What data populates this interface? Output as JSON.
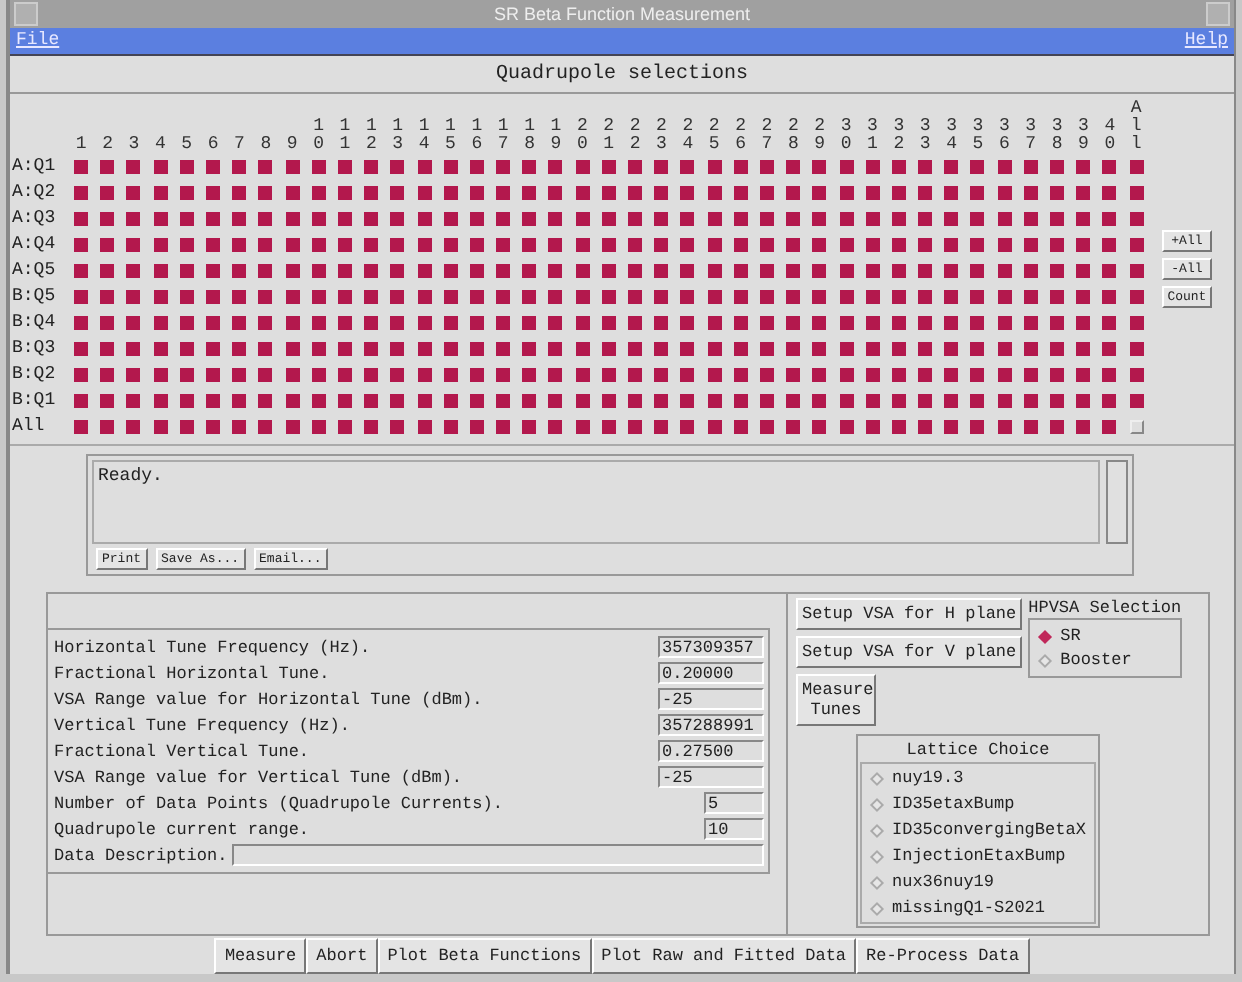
{
  "window": {
    "title": "SR Beta Function Measurement"
  },
  "menu": [
    {
      "label": "File"
    },
    {
      "label": "Help"
    }
  ],
  "grid": {
    "title": "Quadrupole selections",
    "columns": [
      "1",
      "2",
      "3",
      "4",
      "5",
      "6",
      "7",
      "8",
      "9",
      "10",
      "11",
      "12",
      "13",
      "14",
      "15",
      "16",
      "17",
      "18",
      "19",
      "20",
      "21",
      "22",
      "23",
      "24",
      "25",
      "26",
      "27",
      "28",
      "29",
      "30",
      "31",
      "32",
      "33",
      "34",
      "35",
      "36",
      "37",
      "38",
      "39",
      "40",
      "All"
    ],
    "rows": [
      {
        "label": "A:Q1",
        "checked": [
          true,
          true,
          true,
          true,
          true,
          true,
          true,
          true,
          true,
          true,
          true,
          true,
          true,
          true,
          true,
          true,
          true,
          true,
          true,
          true,
          true,
          true,
          true,
          true,
          true,
          true,
          true,
          true,
          true,
          true,
          true,
          true,
          true,
          true,
          true,
          true,
          true,
          true,
          true,
          true,
          true
        ]
      },
      {
        "label": "A:Q2",
        "checked": [
          true,
          true,
          true,
          true,
          true,
          true,
          true,
          true,
          true,
          true,
          true,
          true,
          true,
          true,
          true,
          true,
          true,
          true,
          true,
          true,
          true,
          true,
          true,
          true,
          true,
          true,
          true,
          true,
          true,
          true,
          true,
          true,
          true,
          true,
          true,
          true,
          true,
          true,
          true,
          true,
          true
        ]
      },
      {
        "label": "A:Q3",
        "checked": [
          true,
          true,
          true,
          true,
          true,
          true,
          true,
          true,
          true,
          true,
          true,
          true,
          true,
          true,
          true,
          true,
          true,
          true,
          true,
          true,
          true,
          true,
          true,
          true,
          true,
          true,
          true,
          true,
          true,
          true,
          true,
          true,
          true,
          true,
          true,
          true,
          true,
          true,
          true,
          true,
          true
        ]
      },
      {
        "label": "A:Q4",
        "checked": [
          true,
          true,
          true,
          true,
          true,
          true,
          true,
          true,
          true,
          true,
          true,
          true,
          true,
          true,
          true,
          true,
          true,
          true,
          true,
          true,
          true,
          true,
          true,
          true,
          true,
          true,
          true,
          true,
          true,
          true,
          true,
          true,
          true,
          true,
          true,
          true,
          true,
          true,
          true,
          true,
          true
        ]
      },
      {
        "label": "A:Q5",
        "checked": [
          true,
          true,
          true,
          true,
          true,
          true,
          true,
          true,
          true,
          true,
          true,
          true,
          true,
          true,
          true,
          true,
          true,
          true,
          true,
          true,
          true,
          true,
          true,
          true,
          true,
          true,
          true,
          true,
          true,
          true,
          true,
          true,
          true,
          true,
          true,
          true,
          true,
          true,
          true,
          true,
          true
        ]
      },
      {
        "label": "B:Q5",
        "checked": [
          true,
          true,
          true,
          true,
          true,
          true,
          true,
          true,
          true,
          true,
          true,
          true,
          true,
          true,
          true,
          true,
          true,
          true,
          true,
          true,
          true,
          true,
          true,
          true,
          true,
          true,
          true,
          true,
          true,
          true,
          true,
          true,
          true,
          true,
          true,
          true,
          true,
          true,
          true,
          true,
          true
        ]
      },
      {
        "label": "B:Q4",
        "checked": [
          true,
          true,
          true,
          true,
          true,
          true,
          true,
          true,
          true,
          true,
          true,
          true,
          true,
          true,
          true,
          true,
          true,
          true,
          true,
          true,
          true,
          true,
          true,
          true,
          true,
          true,
          true,
          true,
          true,
          true,
          true,
          true,
          true,
          true,
          true,
          true,
          true,
          true,
          true,
          true,
          true
        ]
      },
      {
        "label": "B:Q3",
        "checked": [
          true,
          true,
          true,
          true,
          true,
          true,
          true,
          true,
          true,
          true,
          true,
          true,
          true,
          true,
          true,
          true,
          true,
          true,
          true,
          true,
          true,
          true,
          true,
          true,
          true,
          true,
          true,
          true,
          true,
          true,
          true,
          true,
          true,
          true,
          true,
          true,
          true,
          true,
          true,
          true,
          true
        ]
      },
      {
        "label": "B:Q2",
        "checked": [
          true,
          true,
          true,
          true,
          true,
          true,
          true,
          true,
          true,
          true,
          true,
          true,
          true,
          true,
          true,
          true,
          true,
          true,
          true,
          true,
          true,
          true,
          true,
          true,
          true,
          true,
          true,
          true,
          true,
          true,
          true,
          true,
          true,
          true,
          true,
          true,
          true,
          true,
          true,
          true,
          true
        ]
      },
      {
        "label": "B:Q1",
        "checked": [
          true,
          true,
          true,
          true,
          true,
          true,
          true,
          true,
          true,
          true,
          true,
          true,
          true,
          true,
          true,
          true,
          true,
          true,
          true,
          true,
          true,
          true,
          true,
          true,
          true,
          true,
          true,
          true,
          true,
          true,
          true,
          true,
          true,
          true,
          true,
          true,
          true,
          true,
          true,
          true,
          true
        ]
      },
      {
        "label": "All",
        "checked": [
          true,
          true,
          true,
          true,
          true,
          true,
          true,
          true,
          true,
          true,
          true,
          true,
          true,
          true,
          true,
          true,
          true,
          true,
          true,
          true,
          true,
          true,
          true,
          true,
          true,
          true,
          true,
          true,
          true,
          true,
          true,
          true,
          true,
          true,
          true,
          true,
          true,
          true,
          true,
          true,
          false
        ]
      }
    ],
    "buttons": [
      {
        "label": "+All"
      },
      {
        "label": "-All"
      },
      {
        "label": "Count"
      }
    ]
  },
  "log": {
    "text": "Ready.",
    "buttons": [
      {
        "label": "Print"
      },
      {
        "label": "Save As..."
      },
      {
        "label": "Email..."
      }
    ]
  },
  "parameters": [
    {
      "label": "Horizontal Tune Frequency (Hz).",
      "value": "357309357",
      "kind": "wide"
    },
    {
      "label": "Fractional Horizontal Tune.",
      "value": "0.20000",
      "kind": "wide"
    },
    {
      "label": "VSA Range value for Horizontal Tune (dBm).",
      "value": "-25",
      "kind": "wide"
    },
    {
      "label": "Vertical Tune Frequency (Hz).",
      "value": "357288991",
      "kind": "wide"
    },
    {
      "label": "Fractional Vertical Tune.",
      "value": "0.27500",
      "kind": "wide"
    },
    {
      "label": "VSA Range value for Vertical Tune (dBm).",
      "value": "-25",
      "kind": "wide"
    },
    {
      "label": "Number of Data Points (Quadrupole Currents).",
      "value": "5",
      "kind": "narrow"
    },
    {
      "label": "Quadrupole current range.",
      "value": "10",
      "kind": "narrow"
    },
    {
      "label": "Data Description.",
      "kind": "long"
    }
  ],
  "vsa_buttons": [
    {
      "label": "Setup VSA for H plane"
    },
    {
      "label": "Setup VSA for V plane"
    },
    {
      "label": "Measure Tunes"
    }
  ],
  "hpvsa": {
    "title": "HPVSA Selection",
    "options": [
      {
        "label": "SR",
        "selected": true
      },
      {
        "label": "Booster",
        "selected": false
      }
    ]
  },
  "lattice": {
    "title": "Lattice Choice",
    "options": [
      {
        "label": "nuy19.3",
        "selected": false
      },
      {
        "label": "ID35etaxBump",
        "selected": false
      },
      {
        "label": "ID35convergingBetaX",
        "selected": false
      },
      {
        "label": "InjectionEtaxBump",
        "selected": false
      },
      {
        "label": "nux36nuy19",
        "selected": false
      },
      {
        "label": "missingQ1-S2021",
        "selected": false
      }
    ]
  },
  "actions": [
    {
      "label": "Measure"
    },
    {
      "label": "Abort"
    },
    {
      "label": "Plot Beta Functions"
    },
    {
      "label": "Plot Raw and Fitted Data"
    },
    {
      "label": "Re-Process Data"
    }
  ]
}
